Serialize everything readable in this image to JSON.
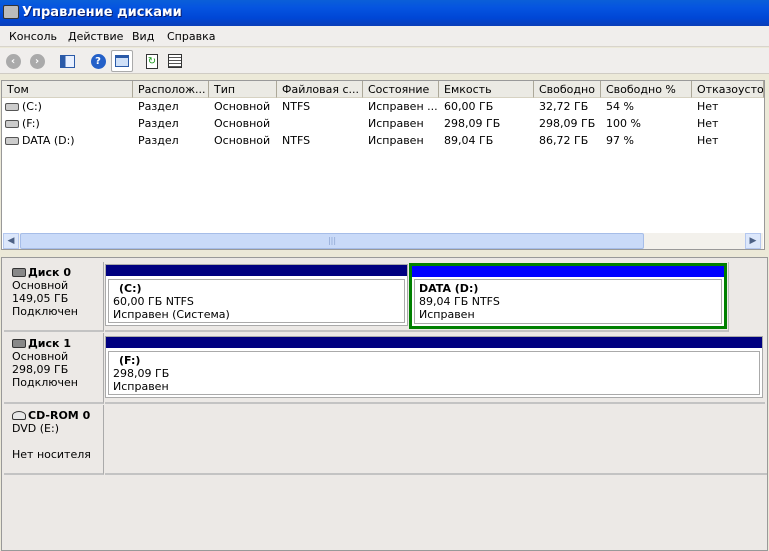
{
  "window": {
    "title": "Управление дисками"
  },
  "menu": [
    "Консоль",
    "Действие",
    "Вид",
    "Справка"
  ],
  "toolbar": {
    "icons": [
      "back-icon",
      "forward-icon",
      "show-hide-tree-icon",
      "help-icon",
      "properties-icon",
      "refresh-icon",
      "settings-icon"
    ]
  },
  "volume_list": {
    "columns": [
      "Том",
      "Располож...",
      "Тип",
      "Файловая с...",
      "Состояние",
      "Емкость",
      "Свободно",
      "Свободно %",
      "Отказоустой"
    ],
    "rows": [
      [
        "(C:)",
        "Раздел",
        "Основной",
        "NTFS",
        "Исправен ...",
        "60,00 ГБ",
        "32,72 ГБ",
        "54 %",
        "Нет"
      ],
      [
        "(F:)",
        "Раздел",
        "Основной",
        "",
        "Исправен",
        "298,09 ГБ",
        "298,09 ГБ",
        "100 %",
        "Нет"
      ],
      [
        "DATA (D:)",
        "Раздел",
        "Основной",
        "NTFS",
        "Исправен",
        "89,04 ГБ",
        "86,72 ГБ",
        "97 %",
        "Нет"
      ]
    ]
  },
  "disks": [
    {
      "name": "Диск 0",
      "type": "Основной",
      "size": "149,05 ГБ",
      "status": "Подключен",
      "partitions": [
        {
          "name": "(C:)",
          "size": "60,00 ГБ NTFS",
          "status": "Исправен (Система)",
          "color": "#000080"
        },
        {
          "name": "DATA  (D:)",
          "size": "89,04 ГБ NTFS",
          "status": "Исправен",
          "color": "#0000ff",
          "selected": true
        }
      ]
    },
    {
      "name": "Диск 1",
      "type": "Основной",
      "size": "298,09 ГБ",
      "status": "Подключен",
      "partitions": [
        {
          "name": "(F:)",
          "size": "298,09 ГБ",
          "status": "Исправен",
          "color": "#000080"
        }
      ]
    },
    {
      "name": "CD-ROM 0",
      "type": "DVD (E:)",
      "status": "Нет носителя"
    }
  ],
  "colors": {
    "selection": "#008000",
    "primary": "#000080",
    "logical": "#0000ff"
  }
}
